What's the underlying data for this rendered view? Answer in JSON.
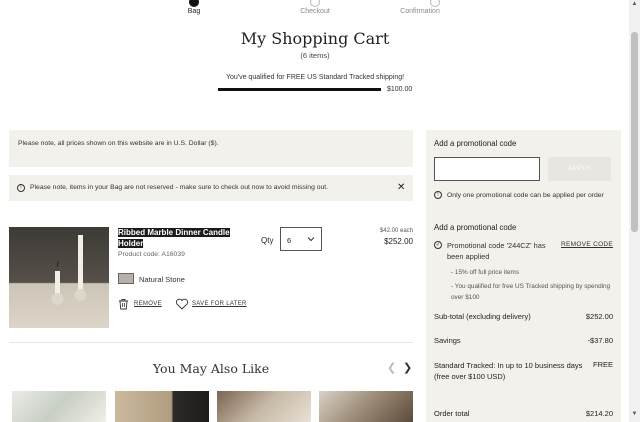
{
  "steps": [
    {
      "label": "Bag",
      "active": true
    },
    {
      "label": "Checkout",
      "active": false
    },
    {
      "label": "Confirmation",
      "active": false
    }
  ],
  "header": {
    "title": "My Shopping Cart",
    "items_count": "(6 items)"
  },
  "shipping": {
    "message": "You've qualified for FREE US Standard Tracked shipping!",
    "threshold": "$100.00",
    "progress": 1.0
  },
  "notices": {
    "currency": "Please note, all prices shown on this website are in U.S. Dollar ($).",
    "reserve": "Please note, items in your Bag are not reserved - make sure to check out now to avoid missing out."
  },
  "item": {
    "name": "Ribbed Marble Dinner Candle Holder",
    "product_code": "Product code: A16039",
    "color": "Natural Stone",
    "color_hex": "#b7b1aa",
    "remove_label": "REMOVE",
    "save_label": "SAVE FOR LATER",
    "qty_label": "Qty",
    "qty_value": "6",
    "price_each": "$42.00 each",
    "price_total": "$252.00"
  },
  "recommendations": {
    "title": "You May Also Like"
  },
  "summary": {
    "promo_heading": "Add a promotional code",
    "apply_label": "APPLY",
    "promo_note": "Only one promotional code can be applied per order",
    "applied_heading": "Add a promotional code",
    "applied_text": "Promotional code '244CZ' has been applied",
    "remove_code_label": "REMOVE CODE",
    "bullet_1": "- 15% off full price items",
    "bullet_2": "- You qualified for free US Tracked shipping by spending over $100",
    "subtotal_label": "Sub-total (excluding delivery)",
    "subtotal_value": "$252.00",
    "savings_label": "Savings",
    "savings_value": "-$37.80",
    "shipping_label": "Standard Tracked: In up to 10 business days (free over $100 USD)",
    "shipping_value": "FREE",
    "order_total_label": "Order total",
    "order_total_value": "$214.20"
  },
  "colors": {
    "accent": "#111111",
    "panel": "#f2f1ec"
  }
}
